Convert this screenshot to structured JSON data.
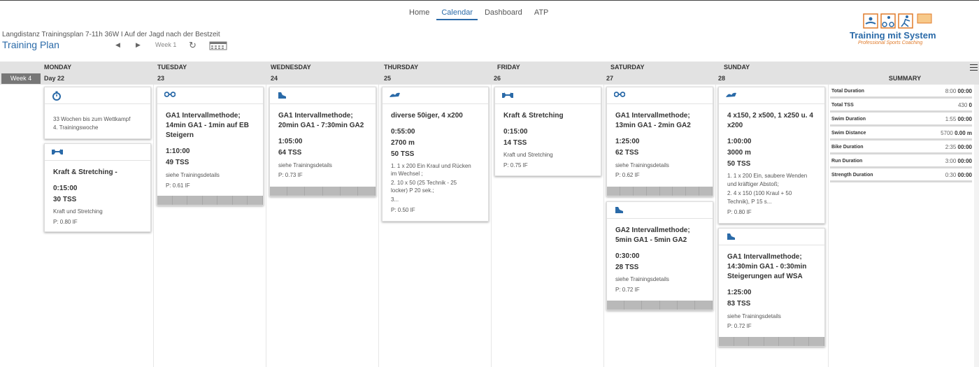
{
  "nav": {
    "home": "Home",
    "calendar": "Calendar",
    "dashboard": "Dashboard",
    "atp": "ATP"
  },
  "plan": {
    "subtitle": "Langdistanz Trainingsplan 7-11h 36W I Auf der Jagd nach der Bestzeit",
    "title": "Training Plan",
    "week_nav": "Week 1"
  },
  "logo": {
    "text": "Training mit System",
    "tagline": "Professional Sports Coaching"
  },
  "week": {
    "label": "Week 4"
  },
  "days": [
    "MONDAY",
    "TUESDAY",
    "WEDNESDAY",
    "THURSDAY",
    "FRIDAY",
    "SATURDAY",
    "SUNDAY"
  ],
  "dates": [
    "Day 22",
    "23",
    "24",
    "25",
    "26",
    "27",
    "28"
  ],
  "summary_title": "SUMMARY",
  "cards": {
    "mon1": {
      "icon": "stopwatch-icon",
      "l1": "33 Wochen bis zum Wettkampf",
      "l2": "4. Trainingswoche"
    },
    "mon2": {
      "icon": "strength-icon",
      "title": "Kraft & Stretching -",
      "dur": "0:15:00",
      "tss": "30 TSS",
      "desc": "Kraft und Stretching",
      "if": "P: 0.80 IF"
    },
    "tue": {
      "icon": "bike-icon",
      "title": "GA1 Intervallmethode; 14min GA1 - 1min auf EB Steigern",
      "dur": "1:10:00",
      "tss": "49 TSS",
      "desc": "siehe Trainingsdetails",
      "if": "P: 0.61 IF"
    },
    "wed": {
      "icon": "run-icon",
      "title": "GA1 Intervallmethode; 20min GA1 - 7:30min GA2",
      "dur": "1:05:00",
      "tss": "64 TSS",
      "desc": "siehe Trainingsdetails",
      "if": "P: 0.73 IF"
    },
    "thu": {
      "icon": "swim-icon",
      "title": "diverse 50iger, 4 x200",
      "dur": "0:55:00",
      "dist": "2700 m",
      "tss": "50 TSS",
      "desc1": "1. 1 x 200 Ein Kraul und Rücken",
      "desc2": "im Wechsel ;",
      "desc3": "2. 10 x 50 (25 Technik - 25",
      "desc4": "locker) P 20 sek.;",
      "desc5": "3...",
      "if": "P: 0.50 IF"
    },
    "fri": {
      "icon": "strength-icon",
      "title": "Kraft & Stretching",
      "dur": "0:15:00",
      "tss": "14 TSS",
      "desc": "Kraft und Stretching",
      "if": "P: 0.75 IF"
    },
    "sat1": {
      "icon": "bike-icon",
      "title": "GA1 Intervallmethode; 13min GA1 - 2min GA2",
      "dur": "1:25:00",
      "tss": "62 TSS",
      "desc": "siehe Trainingsdetails",
      "if": "P: 0.62 IF"
    },
    "sat2": {
      "icon": "run-icon",
      "title": "GA2 Intervallmethode; 5min GA1 - 5min GA2",
      "dur": "0:30:00",
      "tss": "28 TSS",
      "desc": "siehe Trainingsdetails",
      "if": "P: 0.72 IF"
    },
    "sun1": {
      "icon": "swim-icon",
      "title": "4 x150, 2 x500, 1 x250 u. 4 x200",
      "dur": "1:00:00",
      "dist": "3000 m",
      "tss": "50 TSS",
      "desc1": "1. 1 x 200 Ein, saubere Wenden",
      "desc2": "und kräftiger Abstoß;",
      "desc3": "2. 4 x 150 (100 Kraul + 50",
      "desc4": "Technik), P 15 s...",
      "if": "P: 0.80 IF"
    },
    "sun2": {
      "icon": "run-icon",
      "title": "GA1 Intervallmethode; 14:30min GA1 - 0:30min Steigerungen auf WSA",
      "dur": "1:25:00",
      "tss": "83 TSS",
      "desc": "siehe Trainingsdetails",
      "if": "P: 0.72 IF"
    }
  },
  "summary": [
    {
      "label": "Total Duration",
      "plan": "8:00",
      "actual": "00:00"
    },
    {
      "label": "Total TSS",
      "plan": "430",
      "actual": "0"
    },
    {
      "label": "Swim Duration",
      "plan": "1:55",
      "actual": "00:00"
    },
    {
      "label": "Swim Distance",
      "plan": "5700",
      "actual": "0.00 m"
    },
    {
      "label": "Bike Duration",
      "plan": "2:35",
      "actual": "00:00"
    },
    {
      "label": "Run Duration",
      "plan": "3:00",
      "actual": "00:00"
    },
    {
      "label": "Strength Duration",
      "plan": "0:30",
      "actual": "00:00"
    }
  ]
}
